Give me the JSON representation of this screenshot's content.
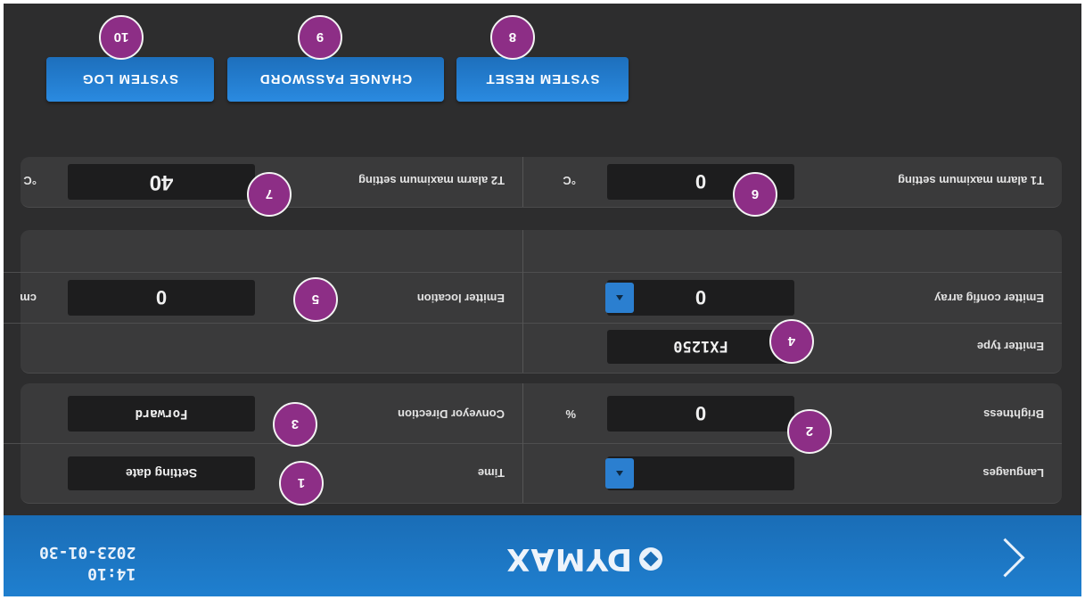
{
  "header": {
    "logo_text": "DYMAX",
    "clock_time": "14:10",
    "clock_date": "2023-01-30"
  },
  "settings": {
    "languages_label": "Languages",
    "languages_value": "",
    "time_label": "Time",
    "time_value": "Setting date",
    "brightness_label": "Brightness",
    "brightness_value": "0",
    "brightness_unit": "%",
    "conveyor_label": "Conveyor Direction",
    "conveyor_value": "Forward",
    "emitter_type_label": "Emitter type",
    "emitter_type_value": "FX1250",
    "emitter_config_label": "Emitter config array",
    "emitter_config_value": "0",
    "emitter_location_label": "Emitter location",
    "emitter_location_value": "0",
    "emitter_location_unit": "cm",
    "t1_label": "T1 alarm maximum setting",
    "t1_value": "0",
    "t1_unit": "°C",
    "t2_label": "T2 alarm maximum setting",
    "t2_value": "40",
    "t2_unit": "°C"
  },
  "buttons": {
    "system_reset": "SYSTEM RESET",
    "change_password": "CHANGE PASSWORD",
    "system_log": "SYSTEM LOG"
  },
  "badges": [
    "1",
    "2",
    "3",
    "4",
    "5",
    "6",
    "7",
    "8",
    "9",
    "10"
  ]
}
